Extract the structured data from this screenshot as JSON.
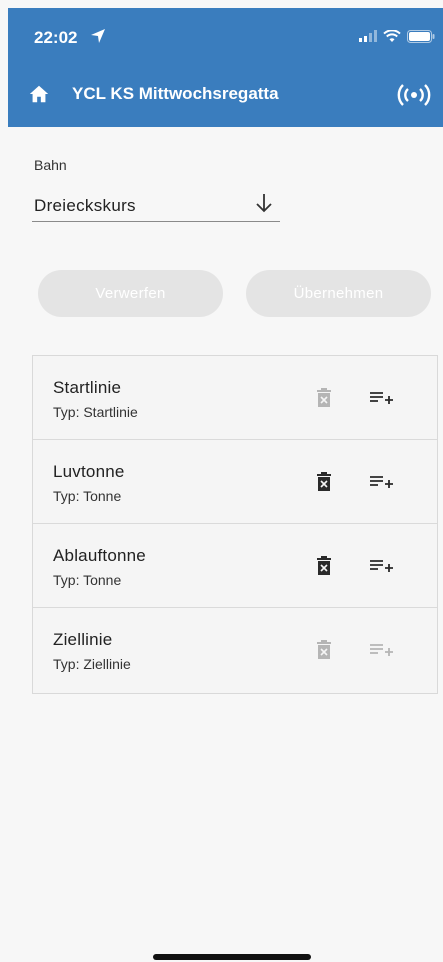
{
  "status_bar": {
    "time": "22:02"
  },
  "app_bar": {
    "title": "YCL KS Mittwochsregatta"
  },
  "course": {
    "label": "Bahn",
    "selected": "Dreieckskurs"
  },
  "actions": {
    "discard_label": "Verwerfen",
    "apply_label": "Übernehmen"
  },
  "marks": [
    {
      "name": "Startlinie",
      "type": "Typ: Startlinie",
      "delete_enabled": false,
      "insert_enabled": true
    },
    {
      "name": "Luvtonne",
      "type": "Typ: Tonne",
      "delete_enabled": true,
      "insert_enabled": true
    },
    {
      "name": "Ablauftonne",
      "type": "Typ: Tonne",
      "delete_enabled": true,
      "insert_enabled": true
    },
    {
      "name": "Ziellinie",
      "type": "Typ: Ziellinie",
      "delete_enabled": false,
      "insert_enabled": false
    }
  ],
  "colors": {
    "app_bar": "#3a7dbe",
    "icon_enabled": "#2a2a2a",
    "icon_disabled": "#b5b5b5",
    "button_disabled_bg": "#e4e4e4"
  }
}
